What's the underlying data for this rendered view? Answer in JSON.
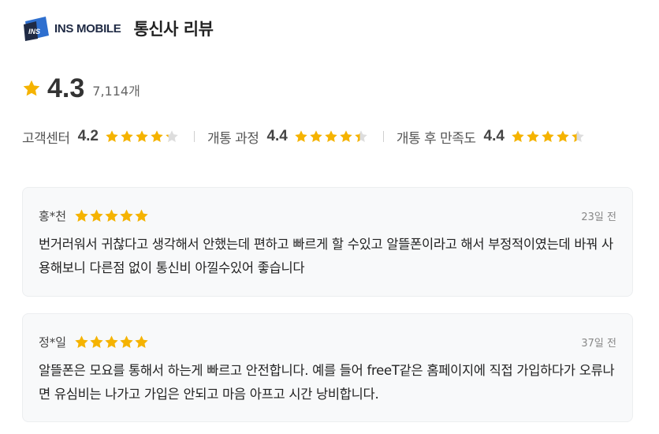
{
  "header": {
    "logo_text": "INS MOBILE",
    "logo_mark_text": "INS",
    "title": "통신사 리뷰"
  },
  "overall": {
    "score": "4.3",
    "count": "7,114개",
    "icon": "star-icon"
  },
  "sub_ratings": [
    {
      "label": "고객센터",
      "score": "4.2",
      "stars": 4.2
    },
    {
      "label": "개통 과정",
      "score": "4.4",
      "stars": 4.4
    },
    {
      "label": "개통 후 만족도",
      "score": "4.4",
      "stars": 4.4
    }
  ],
  "reviews": [
    {
      "reviewer": "홍*천",
      "stars": 5,
      "date": "23일 전",
      "body": "번거러워서 귀찮다고 생각해서 안했는데 편하고 빠르게 할 수있고 알뜰폰이라고 해서 부정적이였는데 바꿔 사용해보니 다른점 없이 통신비 아낄수있어 좋습니다"
    },
    {
      "reviewer": "정*일",
      "stars": 5,
      "date": "37일 전",
      "body": "알뜰폰은 모요를 통해서 하는게 빠르고 안전합니다. 예를 들어 freeT같은 홈페이지에 직접 가입하다가 오류나면 유심비는 나가고 가입은 안되고 마음 아프고 시간 낭비합니다."
    }
  ],
  "colors": {
    "star": "#f5b301",
    "star_empty": "#dddddd",
    "card_bg": "#f8f9fa",
    "brand_navy": "#1f2a44",
    "brand_blue": "#2e6fcf"
  }
}
